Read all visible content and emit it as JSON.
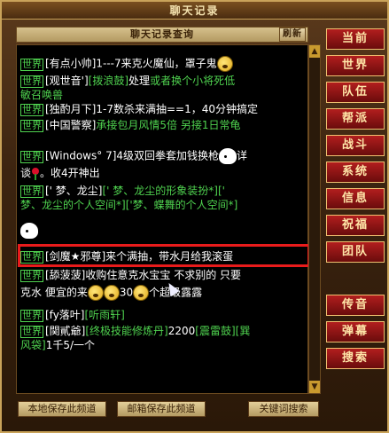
{
  "window": {
    "title": "聊天记录"
  },
  "panel": {
    "title": "聊天记录查询",
    "clear_label": "刷新"
  },
  "channel_tag": "世界",
  "messages": [
    {
      "sender": "[有点小帅]",
      "parts": [
        "1---7来克火魔仙，罩子鬼"
      ]
    },
    {
      "sender": "[观世音']",
      "link": "[拨浪鼓]",
      "parts": [
        "处理",
        "或者换个小将死低",
        "敏召唤兽"
      ]
    },
    {
      "sender": "[独酌月下]",
      "parts": [
        "1-7数杀来满抽==1，40分钟搞定"
      ]
    },
    {
      "sender": "[中国警察]",
      "parts": [
        "承接包月风情5倍 另接1日常龟"
      ]
    },
    {
      "sender": "[Windows°  7]",
      "parts": [
        "4级双回拳套加钱换枪",
        "详",
        "谈",
        "。收4开神出"
      ]
    },
    {
      "sender": "[' 梦、龙尘]",
      "parts": [
        "[' 梦、龙尘的形象装扮*]",
        "['",
        "梦、龙尘的个人空间*]",
        "['梦、蝶舞的个人空间*]"
      ]
    },
    {
      "sender": "[剑魔★邪尊]",
      "parts": [
        "来个满抽，带水月给我滚蛋"
      ]
    },
    {
      "sender": "[舔菠菠]",
      "parts": [
        "收购住意克水宝宝 不求别的 只要",
        "克水 便宜的来",
        "30",
        "个超级露露"
      ]
    },
    {
      "sender": "[fy落叶]",
      "parts": [
        "[听雨轩]"
      ]
    },
    {
      "sender": "[関貳爺]",
      "parts": [
        "[终极技能修炼丹]",
        "2200",
        "[震雷鼓]",
        "[巽",
        "风袋]",
        "1千5/一个"
      ]
    }
  ],
  "right_tabs": [
    "当前",
    "世界",
    "队伍",
    "帮派",
    "战斗",
    "系统",
    "信息",
    "祝福",
    "团队",
    "传音",
    "弹幕",
    "搜索"
  ],
  "bottom_buttons": [
    "本地保存此频道",
    "邮箱保存此频道",
    "关键词搜索"
  ]
}
